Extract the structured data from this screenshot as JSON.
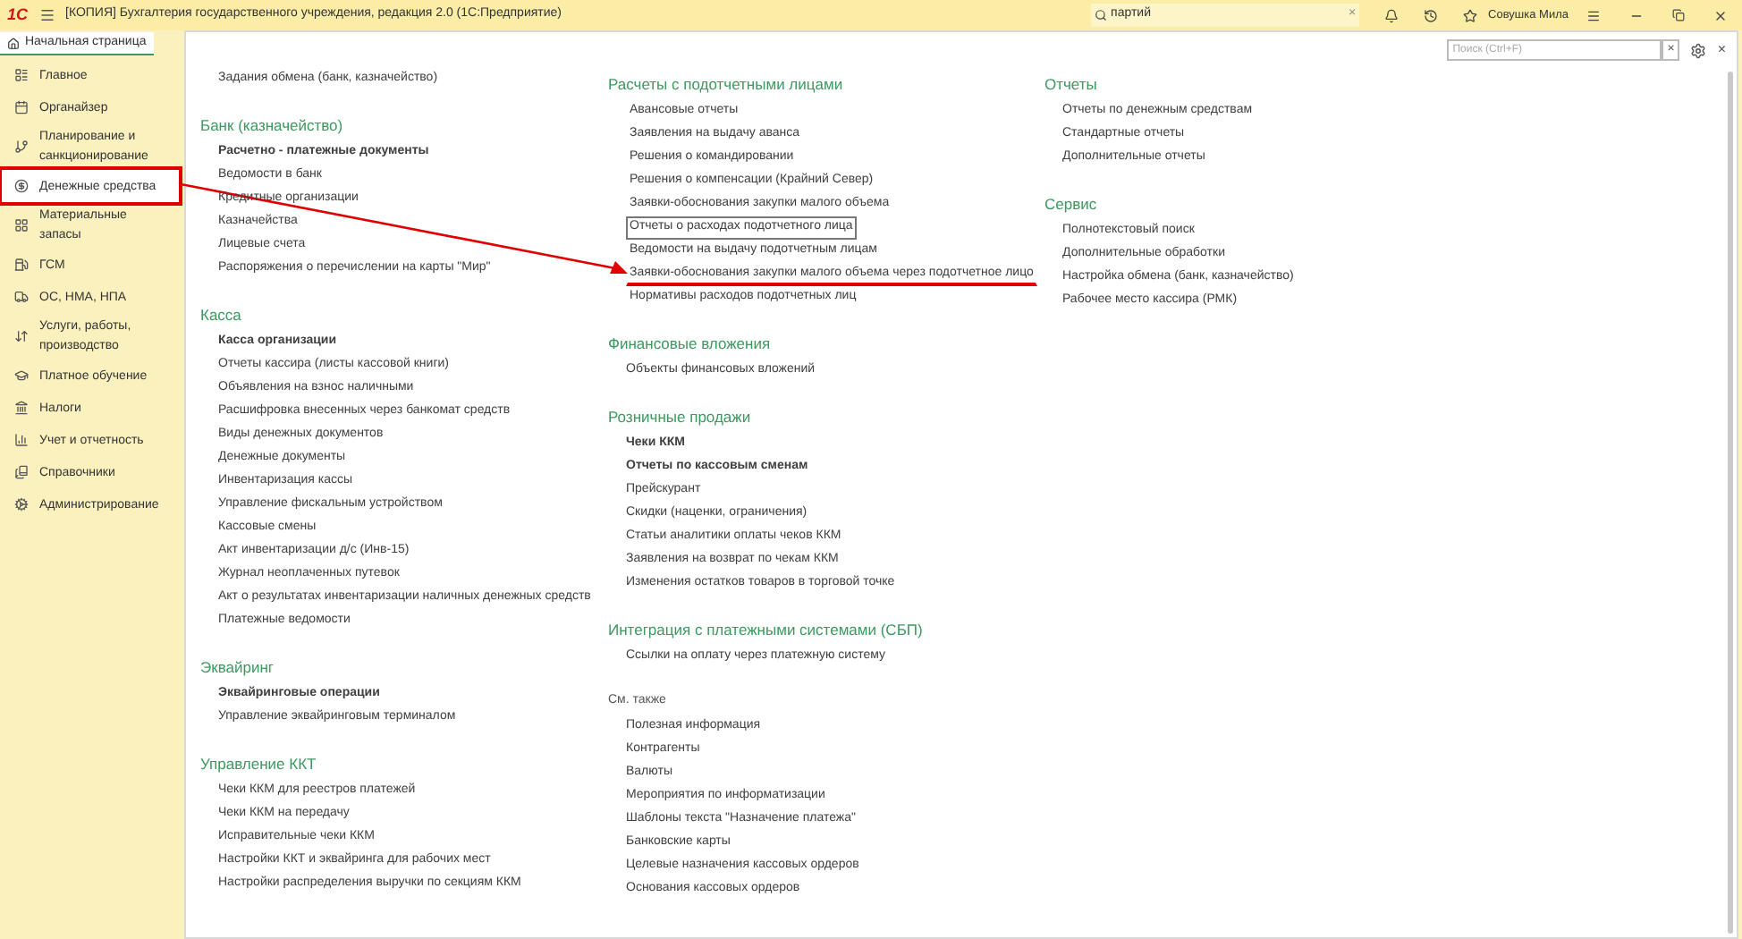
{
  "titlebar": {
    "logo": "1С",
    "title": "[КОПИЯ] Бухгалтерия государственного учреждения, редакция 2.0  (1С:Предприятие)",
    "search_value": "партий",
    "clear": "×",
    "user": "Совушка Мила"
  },
  "tab": {
    "label": "Начальная страница",
    "selected": true
  },
  "sidebar": {
    "items": [
      {
        "label": "Главное",
        "selected": false,
        "highlighted": false
      },
      {
        "label": "Органайзер",
        "selected": false,
        "highlighted": false
      },
      {
        "label": "Планирование и санкционирование",
        "selected": false,
        "highlighted": false
      },
      {
        "label": "Денежные средства",
        "selected": true,
        "highlighted": true
      },
      {
        "label": "Материальные запасы",
        "selected": false,
        "highlighted": false
      },
      {
        "label": "ГСМ",
        "selected": false,
        "highlighted": false
      },
      {
        "label": "ОС, НМА, НПА",
        "selected": false,
        "highlighted": false
      },
      {
        "label": "Услуги, работы, производство",
        "selected": false,
        "highlighted": false
      },
      {
        "label": "Платное обучение",
        "selected": false,
        "highlighted": false
      },
      {
        "label": "Налоги",
        "selected": false,
        "highlighted": false
      },
      {
        "label": "Учет и отчетность",
        "selected": false,
        "highlighted": false
      },
      {
        "label": "Справочники",
        "selected": false,
        "highlighted": false
      },
      {
        "label": "Администрирование",
        "selected": false,
        "highlighted": false
      }
    ]
  },
  "content": {
    "search_placeholder": "Поиск (Ctrl+F)",
    "clear": "×",
    "close": "×",
    "columns": [
      [
        {
          "kind": "plain",
          "items": [
            "Задания обмена (банк, казначейство)"
          ]
        },
        {
          "kind": "group",
          "title": "Банк (казначейство)",
          "main_items": [
            "Расчетно - платежные документы"
          ],
          "items": [
            "Ведомости в банк",
            "Кредитные организации",
            "Казначейства",
            "Лицевые счета",
            "Распоряжения о перечислении на карты \"Мир\""
          ]
        },
        {
          "kind": "group",
          "title": "Касса",
          "main_items": [
            "Касса организации"
          ],
          "items": [
            "Отчеты кассира (листы кассовой книги)",
            "Объявления на взнос наличными",
            "Расшифровка внесенных через банкомат средств",
            "Виды денежных документов",
            "Денежные документы",
            "Инвентаризация кассы",
            "Управление фискальным устройством",
            "Кассовые смены",
            "Акт инвентаризации д/с (Инв-15)",
            "Журнал неоплаченных путевок",
            "Акт о результатах инвентаризации наличных денежных средств",
            "Платежные ведомости"
          ]
        },
        {
          "kind": "group",
          "title": "Эквайринг",
          "main_items": [
            "Эквайринговые операции"
          ],
          "items": [
            "Управление эквайринговым терминалом"
          ]
        },
        {
          "kind": "group",
          "title": "Управление ККТ",
          "items": [
            "Чеки ККМ для реестров платежей",
            "Чеки ККМ на передачу",
            "Исправительные чеки ККМ",
            "Настройки ККТ и эквайринга для рабочих мест",
            "Настройки распределения выручки по секциям ККМ"
          ]
        }
      ],
      [
        {
          "kind": "group",
          "title": "Расчеты с подотчетными лицами",
          "items": [
            {
              "label": "Авансовые отчеты",
              "focused": false,
              "marked": false
            },
            {
              "label": "Заявления на выдачу аванса",
              "focused": false,
              "marked": false
            },
            {
              "label": "Решения о командировании",
              "focused": false,
              "marked": false
            },
            {
              "label": "Решения о компенсации (Крайний Север)",
              "focused": false,
              "marked": false
            },
            {
              "label": "Заявки-обоснования закупки малого объема",
              "focused": false,
              "marked": false
            },
            {
              "label": "Отчеты о расходах подотчетного лица",
              "focused": true,
              "marked": false
            },
            {
              "label": "Ведомости на выдачу подотчетным лицам",
              "focused": false,
              "marked": false
            },
            {
              "label": "Заявки-обоснования закупки малого объема через подотчетное лицо",
              "focused": false,
              "marked": true
            },
            {
              "label": "Нормативы расходов подотчетных лиц",
              "focused": false,
              "marked": false
            }
          ]
        },
        {
          "kind": "group",
          "title": "Финансовые вложения",
          "items": [
            "Объекты финансовых вложений"
          ]
        },
        {
          "kind": "group",
          "title": "Розничные продажи",
          "main_items": [
            "Чеки ККМ",
            "Отчеты по кассовым сменам"
          ],
          "items": [
            "Прейскурант",
            "Скидки (наценки, ограничения)",
            "Статьи аналитики оплаты чеков ККМ",
            "Заявления на возврат по чекам ККМ",
            "Изменения остатков товаров в торговой точке"
          ]
        },
        {
          "kind": "group",
          "title": "Интеграция с платежными системами (СБП)",
          "items": [
            "Ссылки на оплату через платежную систему"
          ]
        },
        {
          "kind": "see_also",
          "title": "См. также",
          "items": [
            "Полезная информация",
            "Контрагенты",
            "Валюты",
            "Мероприятия по информатизации",
            "Шаблоны текста \"Назначение платежа\"",
            "Банковские карты",
            "Целевые назначения кассовых ордеров",
            "Основания кассовых ордеров"
          ]
        }
      ],
      [
        {
          "kind": "group",
          "title": "Отчеты",
          "items": [
            "Отчеты по денежным средствам",
            "Стандартные отчеты",
            "Дополнительные отчеты"
          ]
        },
        {
          "kind": "group",
          "title": "Сервис",
          "items": [
            "Полнотекстовый поиск",
            "Дополнительные обработки",
            "Настройка обмена (банк, казначейство)",
            "Рабочее место кассира (РМК)"
          ]
        }
      ]
    ]
  }
}
